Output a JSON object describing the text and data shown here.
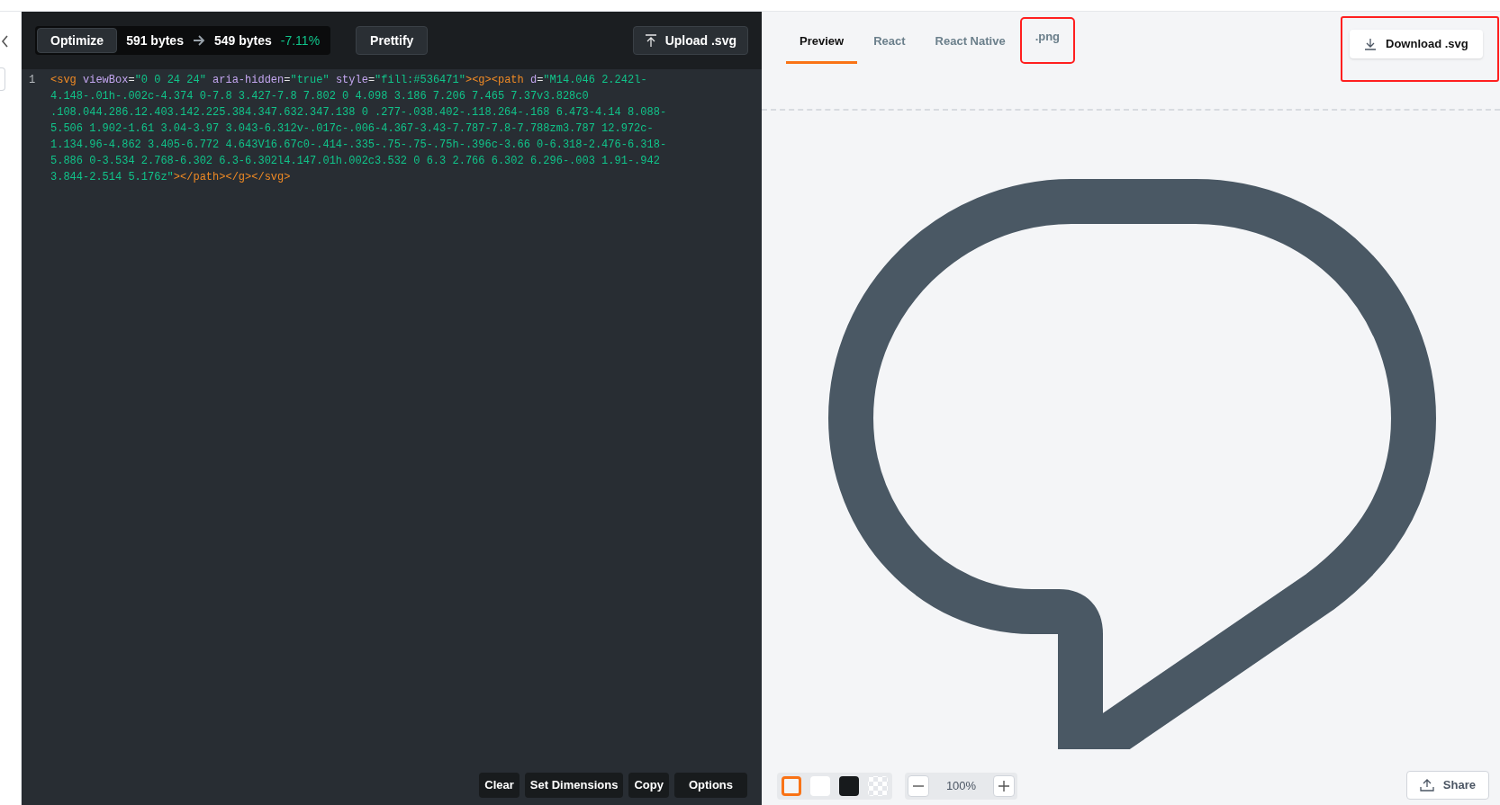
{
  "editor": {
    "optimize_button": "Optimize",
    "size_before": "591 bytes",
    "size_after": "549 bytes",
    "size_change": "-7.11%",
    "prettify_button": "Prettify",
    "upload_button": "Upload .svg",
    "lines": [
      {
        "number": "1",
        "tokens": [
          {
            "kind": "tag",
            "text": "<svg"
          },
          {
            "kind": "attr",
            "text": " viewBox"
          },
          {
            "kind": "punct",
            "text": "="
          },
          {
            "kind": "value",
            "text": "\"0 0 24 24\""
          },
          {
            "kind": "attr",
            "text": " aria-hidden"
          },
          {
            "kind": "punct",
            "text": "="
          },
          {
            "kind": "value",
            "text": "\"true\""
          },
          {
            "kind": "attr",
            "text": " style"
          },
          {
            "kind": "punct",
            "text": "="
          },
          {
            "kind": "value",
            "text": "\"fill:#536471\""
          },
          {
            "kind": "tag",
            "text": "><g><path"
          },
          {
            "kind": "attr",
            "text": " d"
          },
          {
            "kind": "punct",
            "text": "="
          },
          {
            "kind": "value",
            "text": "\"M14.046 2.242l-4.148-.01h-.002c-4.374 0-7.8 3.427-7.8 7.802 0 4.098 3.186 7.206 7.465 7.37v3.828c0 .108.044.286.12.403.142.225.384.347.632.347.138 0 .277-.038.402-.118.264-.168 6.473-4.14 8.088-5.506 1.902-1.61 3.04-3.97 3.043-6.312v-.017c-.006-4.367-3.43-7.787-7.8-7.788zm3.787 12.972c-1.134.96-4.862 3.405-6.772 4.643V16.67c0-.414-.335-.75-.75-.75h-.396c-3.66 0-6.318-2.476-6.318-5.886 0-3.534 2.768-6.302 6.3-6.302l4.147.01h.002c3.532 0 6.3 2.766 6.302 6.296-.003 1.91-.942 3.844-2.514 5.176z\""
          },
          {
            "kind": "tag",
            "text": "></path></g></svg>"
          }
        ]
      }
    ],
    "actions": [
      "Clear",
      "Set Dimensions",
      "Copy",
      "Options"
    ]
  },
  "preview": {
    "tabs": [
      {
        "label": "Preview",
        "selected": true,
        "highlighted": false
      },
      {
        "label": "React",
        "selected": false,
        "highlighted": false
      },
      {
        "label": "React Native",
        "selected": false,
        "highlighted": false
      },
      {
        "label": ".png",
        "selected": false,
        "highlighted": true
      }
    ],
    "download_button": {
      "label": "Download .svg",
      "highlighted": true
    },
    "backgrounds": [
      {
        "kind": "light",
        "selected": true
      },
      {
        "kind": "white",
        "selected": false
      },
      {
        "kind": "dark",
        "selected": false
      },
      {
        "kind": "transparent",
        "selected": false
      }
    ],
    "zoom": "100%",
    "share_button": "Share"
  }
}
